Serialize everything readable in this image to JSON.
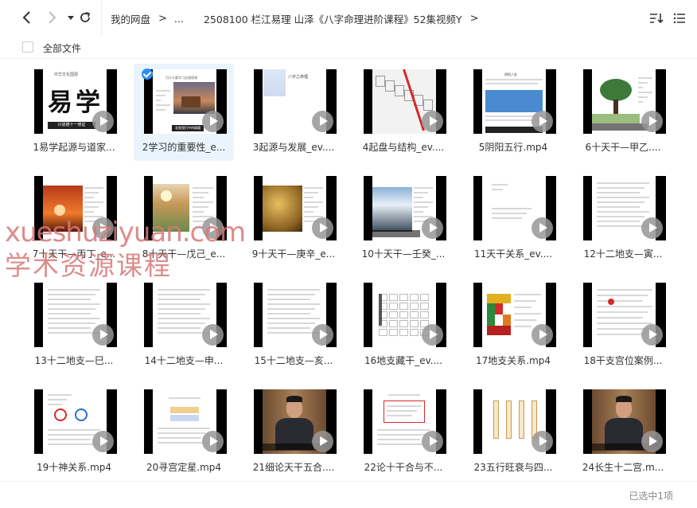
{
  "nav": {
    "back_icon": "chevron-left-icon",
    "forward_icon": "chevron-right-icon",
    "history_icon": "caret-down-icon",
    "refresh_icon": "refresh-icon"
  },
  "breadcrumb": {
    "root": "我的网盘",
    "ellipsis": "...",
    "current": "2508100 栏江易理 山泽《八字命理进阶课程》52集视频Y"
  },
  "toolbar": {
    "sort_icon": "sort-icon",
    "view_icon": "list-view-icon"
  },
  "select_all_label": "全部文件",
  "files": [
    {
      "name": "1易学起源与道家...",
      "selected": false
    },
    {
      "name": "2学习的重要性_e...",
      "selected": true
    },
    {
      "name": "3起源与发展_ev....",
      "selected": false
    },
    {
      "name": "4起盘与结构_ev....",
      "selected": false
    },
    {
      "name": "5阴阳五行.mp4",
      "selected": false
    },
    {
      "name": "6十天干—甲乙....",
      "selected": false
    },
    {
      "name": "7十天干—丙丁_e...",
      "selected": false
    },
    {
      "name": "8十天干—戊己_e...",
      "selected": false
    },
    {
      "name": "9十天干—庚辛_e...",
      "selected": false
    },
    {
      "name": "10十天干—壬癸_...",
      "selected": false
    },
    {
      "name": "11天干关系_ev....",
      "selected": false
    },
    {
      "name": "12十二地支—寅...",
      "selected": false
    },
    {
      "name": "13十二地支—巳...",
      "selected": false
    },
    {
      "name": "14十二地支—申...",
      "selected": false
    },
    {
      "name": "15十二地支—亥...",
      "selected": false
    },
    {
      "name": "16地支藏干_ev....",
      "selected": false
    },
    {
      "name": "17地支关系.mp4",
      "selected": false
    },
    {
      "name": "18干支宫位案例...",
      "selected": false
    },
    {
      "name": "19十神关系.mp4",
      "selected": false
    },
    {
      "name": "20寻宫定星.mp4",
      "selected": false
    },
    {
      "name": "21细论天干五合....",
      "selected": false
    },
    {
      "name": "22论十干合与不...",
      "selected": false
    },
    {
      "name": "23五行旺衰与四...",
      "selected": false
    },
    {
      "name": "24长生十二宫.m...",
      "selected": false
    }
  ],
  "thumb_text": {
    "t1_top": "中华文化国源",
    "t1_big": "易学",
    "t1_cap": "兴道德十一修证",
    "t2_title": "为什么要学习这道理课",
    "t2_cap": "发掘我们中的精髓",
    "t3_title": "八字之命理",
    "t5_title": "阴阳八卦"
  },
  "status": {
    "selection": "已选中1项"
  },
  "watermark": {
    "line1": "xueshuziyuan.com",
    "line2": "学术资源课程"
  },
  "colors": {
    "accent": "#2b8ff3",
    "selected_bg": "#eaf4fd",
    "watermark": "#d67878"
  }
}
